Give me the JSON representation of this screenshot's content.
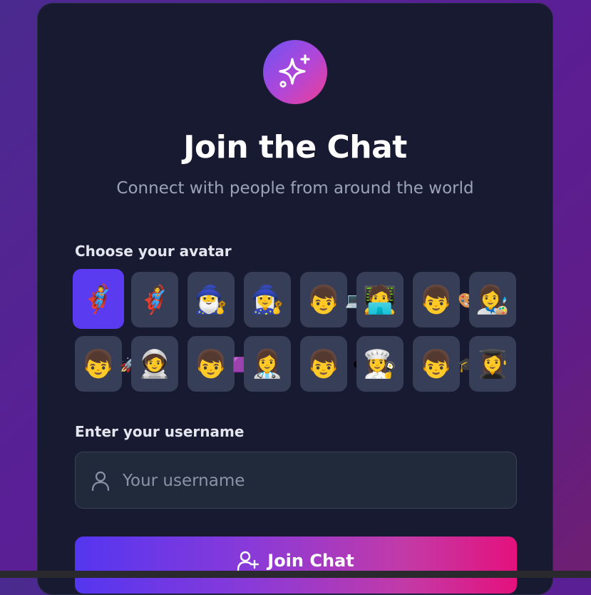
{
  "header": {
    "title": "Join the Chat",
    "subtitle": "Connect with people from around the world",
    "logo_icon": "sparkles-icon"
  },
  "avatar_section": {
    "label": "Choose your avatar",
    "selected_index": 0,
    "avatars": [
      {
        "emoji": "🦸‍♂️",
        "overlap": ""
      },
      {
        "emoji": "🦸",
        "overlap": ""
      },
      {
        "emoji": "🧙‍♂️",
        "overlap": ""
      },
      {
        "emoji": "🧙‍♀️",
        "overlap": ""
      },
      {
        "emoji": "👦",
        "overlap": "💻"
      },
      {
        "emoji": "🧑‍💻",
        "overlap": ""
      },
      {
        "emoji": "👦",
        "overlap": "🎨"
      },
      {
        "emoji": "👩‍🎨",
        "overlap": ""
      },
      {
        "emoji": "👦",
        "overlap": "🚀"
      },
      {
        "emoji": "🧑‍🚀",
        "overlap": ""
      },
      {
        "emoji": "👦",
        "overlap": "🟪"
      },
      {
        "emoji": "👩‍⚕️",
        "overlap": ""
      },
      {
        "emoji": "👦",
        "overlap": "⚫"
      },
      {
        "emoji": "👩‍🍳",
        "overlap": ""
      },
      {
        "emoji": "👦",
        "overlap": "🎓"
      },
      {
        "emoji": "👩‍🎓",
        "overlap": ""
      }
    ]
  },
  "username_section": {
    "label": "Enter your username",
    "placeholder": "Your username",
    "value": "",
    "icon": "user-icon"
  },
  "join_button": {
    "label": "Join Chat",
    "icon": "user-plus-icon"
  },
  "colors": {
    "card_background": "#181a31",
    "accent_purple": "#5a3bf0",
    "accent_pink": "#e4117c",
    "avatar_tile": "#363f57",
    "input_background": "#212a3b"
  }
}
